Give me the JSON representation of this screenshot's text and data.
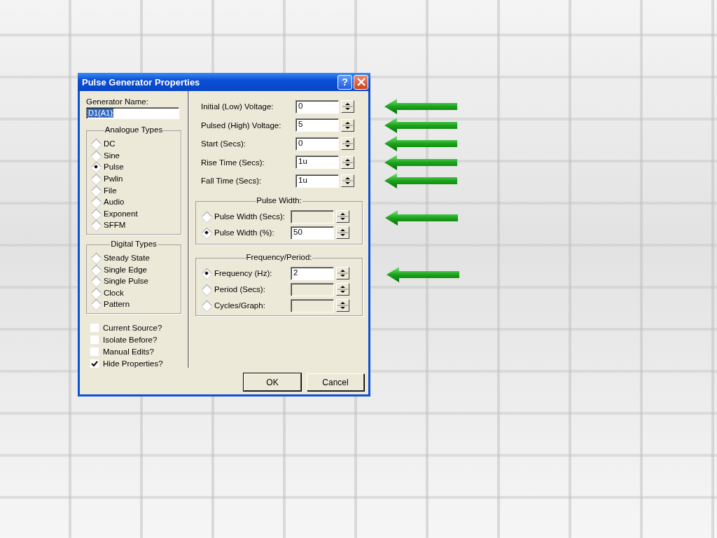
{
  "window": {
    "title": "Pulse Generator Properties",
    "help_button": "?"
  },
  "generator_name": {
    "label": "Generator Name:",
    "value": "D1(A1)"
  },
  "analogue_types": {
    "title": "Analogue Types",
    "options": [
      {
        "label": "DC",
        "selected": false
      },
      {
        "label": "Sine",
        "selected": false
      },
      {
        "label": "Pulse",
        "selected": true
      },
      {
        "label": "Pwlin",
        "selected": false
      },
      {
        "label": "File",
        "selected": false
      },
      {
        "label": "Audio",
        "selected": false
      },
      {
        "label": "Exponent",
        "selected": false
      },
      {
        "label": "SFFM",
        "selected": false
      }
    ]
  },
  "digital_types": {
    "title": "Digital Types",
    "options": [
      {
        "label": "Steady State",
        "selected": false
      },
      {
        "label": "Single Edge",
        "selected": false
      },
      {
        "label": "Single Pulse",
        "selected": false
      },
      {
        "label": "Clock",
        "selected": false
      },
      {
        "label": "Pattern",
        "selected": false
      }
    ]
  },
  "checkboxes": [
    {
      "label": "Current Source?",
      "checked": false
    },
    {
      "label": "Isolate Before?",
      "checked": false
    },
    {
      "label": "Manual Edits?",
      "checked": false
    },
    {
      "label": "Hide Properties?",
      "checked": true
    }
  ],
  "fields": [
    {
      "label": "Initial (Low) Voltage:",
      "value": "0",
      "pointed": true
    },
    {
      "label": "Pulsed (High) Voltage:",
      "value": "5",
      "pointed": true
    },
    {
      "label": "Start (Secs):",
      "value": "0",
      "pointed": true
    },
    {
      "label": "Rise Time (Secs):",
      "value": "1u",
      "pointed": true
    },
    {
      "label": "Fall Time (Secs):",
      "value": "1u",
      "pointed": true
    }
  ],
  "pulse_width": {
    "title": "Pulse Width:",
    "options": [
      {
        "label": "Pulse Width (Secs):",
        "selected": false,
        "pointed": true
      },
      {
        "label": "Pulse Width (%):",
        "selected": true,
        "value": "50",
        "pointed": false
      }
    ]
  },
  "frequency_period": {
    "title": "Frequency/Period:",
    "options": [
      {
        "label": "Frequency (Hz):",
        "selected": true,
        "value": "2",
        "pointed": true
      },
      {
        "label": "Period (Secs):",
        "selected": false,
        "pointed": false
      },
      {
        "label": "Cycles/Graph:",
        "selected": false,
        "pointed": false
      }
    ]
  },
  "buttons": [
    "OK",
    "Cancel"
  ]
}
